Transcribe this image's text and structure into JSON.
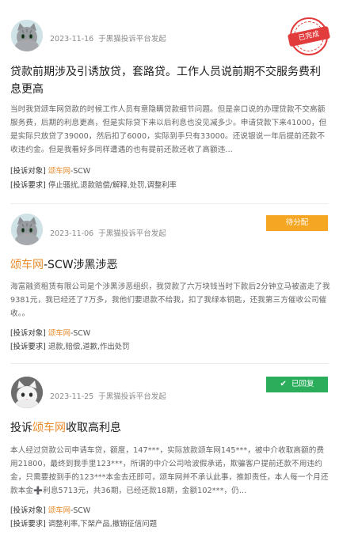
{
  "posts": [
    {
      "date": "2023-11-16",
      "source": "于黑猫投诉平台发起",
      "status": "已完成",
      "title": "贷款前期涉及引诱放贷，套路贷。工作人员说前期不交服务费利息更高",
      "title_highlight": "",
      "description": "当时我贷颂车网贷款的时候工作人员有意隐瞒贷款细节问题。但是亲口说的办理贷款不交高额服务费，后期的利息更高，但是实际贷下来以后利息也没见减多少。申请贷款下来41000，但是实际只放贷了39000，然后扣了6000，实际到手只有33000。还说银说一年后提前还款不收违约金。但是我看好多同样遭遇的也有提前还款还收了高额违...",
      "target_label": "[投诉对象]",
      "target_value": "颂车网",
      "target_suffix": "-SCW",
      "demand_label": "[投诉要求]",
      "demand_value": "停止骚扰,退款赔偿/解释,处罚,调整利率"
    },
    {
      "date": "2023-11-06",
      "source": "于黑猫投诉平台发起",
      "status": "待分配",
      "title_highlight": "颂车网",
      "title": "-SCW涉黑涉恶",
      "description": "海富融资租赁有限公司是个涉黑涉恶组织，我贷款了六万块钱当时下款后2分钟立马被盗走了我9381元，我已经还了7万多，我他们要退款不给我，扣了我绿本钥匙，还我第三方催收公司催收。。",
      "target_label": "[投诉对象]",
      "target_value": "颂车网",
      "target_suffix": "-SCW",
      "demand_label": "[投诉要求]",
      "demand_value": "退款,赔偿,道歉,作出处罚"
    },
    {
      "date": "2023-11-25",
      "source": "于黑猫投诉平台发起",
      "status": "已回复",
      "title_prefix": "投诉",
      "title_highlight": "颂车网",
      "title": "收取高利息",
      "description": "本人经过贷款公司申请车贷，额度，147***，实际放款颂车网145***，被中介收取高额的费用21800，最终到我手里123***，所谓的中介公司哈波假承诺，欺骗客户提前还款不用违约金，只需要按到手的123***本金去还即可，颂车网并不承认此事，推卸责任，本人每一个月还款本金➕利息5713元，共36期，已经还款18期，金额102***，仍...",
      "target_label": "[投诉对象]",
      "target_value": "颂车网",
      "target_suffix": "-SCW",
      "demand_label": "[投诉要求]",
      "demand_value": "调整利率,下架产品,撤销征信问题"
    }
  ],
  "colors": {
    "highlight": "#e88a2a",
    "stamp_red": "#e23b3b",
    "tag_orange": "#f5a623",
    "tag_green": "#2aae5b"
  },
  "icons": {
    "status_replied": "check-icon"
  }
}
